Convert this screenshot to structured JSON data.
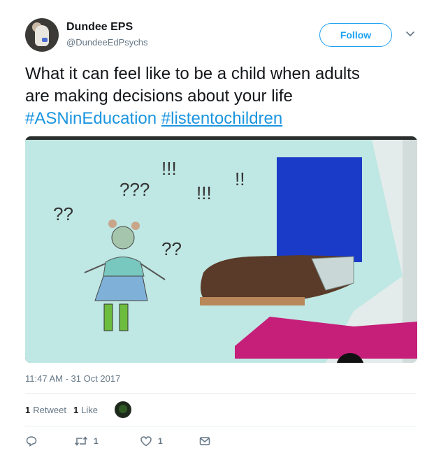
{
  "user": {
    "name": "Dundee EPS",
    "handle": "@DundeeEdPsychs"
  },
  "follow_label": "Follow",
  "tweet": {
    "line1": "What it can feel like to be a child when adults",
    "line2": "are making decisions about your life",
    "hashtag1": "#ASNinEducation",
    "hashtag2": "#listentochildren"
  },
  "timestamp": "11:47 AM - 31 Oct 2017",
  "stats": {
    "retweets_count": "1",
    "retweets_label": "Retweet",
    "likes_count": "1",
    "likes_label": "Like"
  },
  "actions": {
    "retweet_count": "1",
    "like_count": "1"
  },
  "colors": {
    "link": "#1b95e0",
    "follow": "#1da1f2",
    "muted": "#657786",
    "text": "#14171a"
  },
  "icons": [
    "chevron-down-icon",
    "reply-icon",
    "retweet-icon",
    "heart-icon",
    "message-icon"
  ]
}
